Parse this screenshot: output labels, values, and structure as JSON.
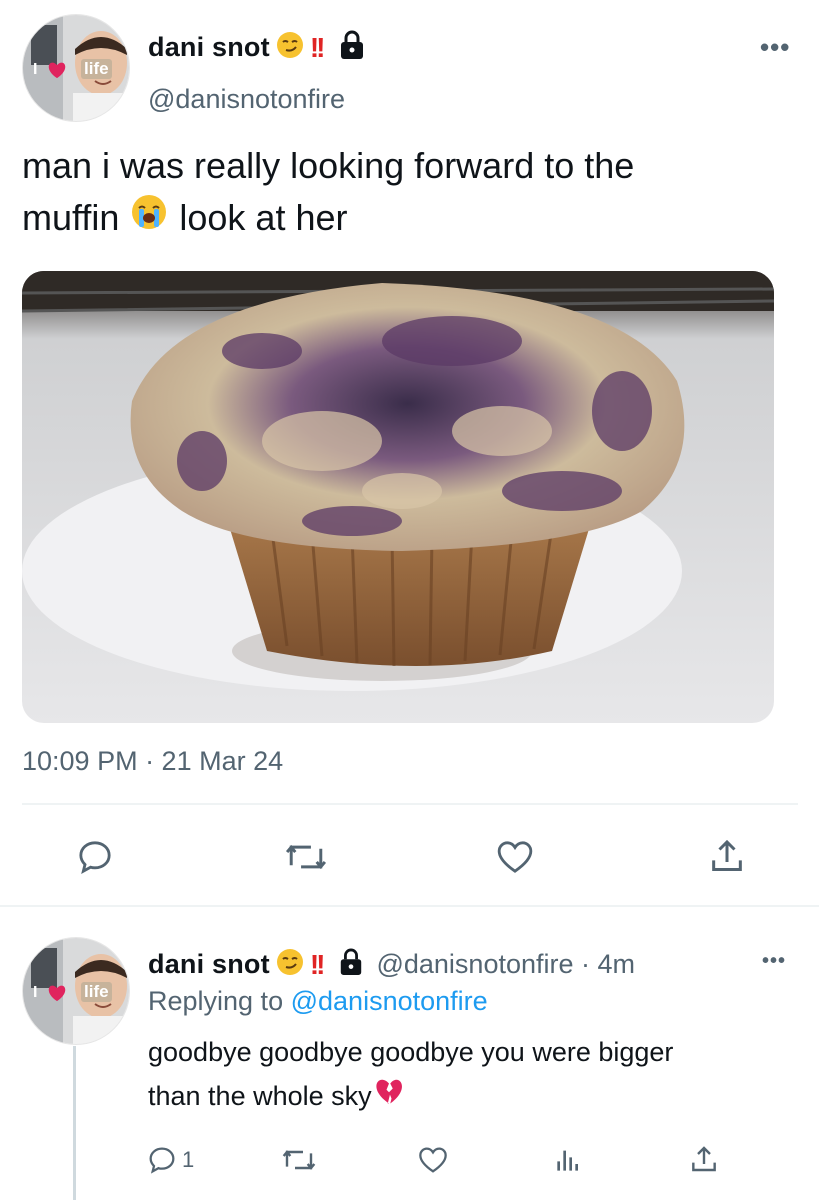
{
  "main_tweet": {
    "author_name": "dani snot",
    "handle": "@danisnotonfire",
    "badges": "!!",
    "text_line1": "man i was really looking forward to the",
    "text_line2a": "muffin",
    "text_line2b": "look at her",
    "timestamp": "10:09 PM · 21 Mar 24",
    "more_label": "•••"
  },
  "avatar": {
    "sticker_text": "life",
    "sticker_prefix": "I"
  },
  "reply_tweet": {
    "author_name": "dani snot",
    "badges": "!!",
    "handle_time": "@danisnotonfire · 4m",
    "replying_prefix": "Replying to",
    "replying_handle": "@danisnotonfire",
    "text_line1": "goodbye goodbye goodbye you were bigger",
    "text_line2": "than the whole sky",
    "reply_count": "1",
    "more_label": "•••"
  },
  "icons": {
    "main_actions": [
      "reply-icon",
      "retweet-icon",
      "like-icon",
      "share-icon"
    ],
    "reply_actions": [
      "reply-icon",
      "retweet-icon",
      "like-icon",
      "views-icon",
      "share-icon"
    ]
  },
  "colors": {
    "text": "#0f1419",
    "secondary": "#536471",
    "link": "#1d9bf0",
    "divider": "#eff3f4",
    "heart": "#e0245e"
  }
}
